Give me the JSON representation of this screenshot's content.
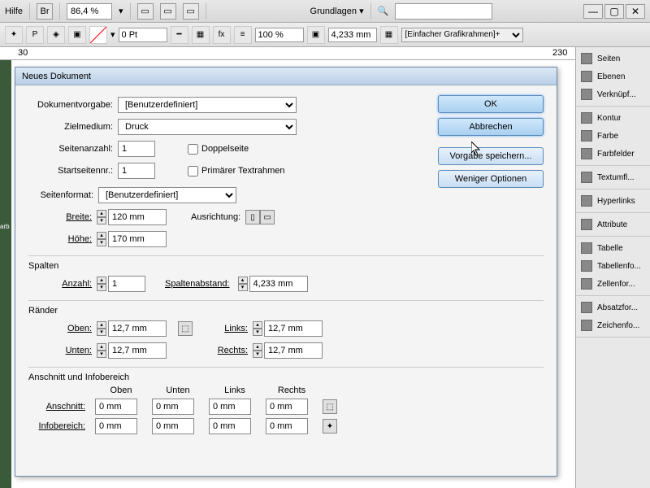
{
  "topbar": {
    "help": "Hilfe",
    "br": "Br",
    "zoom": "86,4 %",
    "workspace": "Grundlagen",
    "frame_preset": "[Einfacher Grafikrahmen]+"
  },
  "ctrl": {
    "weight": "0 Pt",
    "pct": "100 %",
    "measure": "4,233 mm"
  },
  "ruler": {
    "t1": "30",
    "t2": "230"
  },
  "dialog": {
    "title": "Neues Dokument",
    "preset_lbl": "Dokumentvorgabe:",
    "preset": "[Benutzerdefiniert]",
    "intent_lbl": "Zielmedium:",
    "intent": "Druck",
    "pages_lbl": "Seitenanzahl:",
    "pages": "1",
    "facing": "Doppelseite",
    "start_lbl": "Startseitennr.:",
    "start": "1",
    "primary": "Primärer Textrahmen",
    "size_lbl": "Seitenformat:",
    "size": "[Benutzerdefiniert]",
    "width_lbl": "Breite:",
    "width": "120 mm",
    "height_lbl": "Höhe:",
    "height": "170 mm",
    "orient_lbl": "Ausrichtung:",
    "cols_title": "Spalten",
    "cols_lbl": "Anzahl:",
    "cols": "1",
    "gutter_lbl": "Spaltenabstand:",
    "gutter": "4,233 mm",
    "marg_title": "Ränder",
    "top": "Oben:",
    "bottom": "Unten:",
    "left": "Links:",
    "right": "Rechts:",
    "marg": "12,7 mm",
    "bleed_title": "Anschnitt und Infobereich",
    "h_top": "Oben",
    "h_bottom": "Unten",
    "h_left": "Links",
    "h_right": "Rechts",
    "bleed_lbl": "Anschnitt:",
    "slug_lbl": "Infobereich:",
    "zero": "0 mm",
    "ok": "OK",
    "cancel": "Abbrechen",
    "save": "Vorgabe speichern...",
    "less": "Weniger Optionen"
  },
  "panels": [
    [
      {
        "ic": "seiten-icon",
        "l": "Seiten"
      },
      {
        "ic": "ebenen-icon",
        "l": "Ebenen"
      },
      {
        "ic": "links-icon",
        "l": "Verknüpf..."
      }
    ],
    [
      {
        "ic": "kontur-icon",
        "l": "Kontur"
      },
      {
        "ic": "farbe-icon",
        "l": "Farbe"
      },
      {
        "ic": "farbfelder-icon",
        "l": "Farbfelder"
      }
    ],
    [
      {
        "ic": "textumfl-icon",
        "l": "Textumfl..."
      }
    ],
    [
      {
        "ic": "hyperlinks-icon",
        "l": "Hyperlinks"
      }
    ],
    [
      {
        "ic": "attribute-icon",
        "l": "Attribute"
      }
    ],
    [
      {
        "ic": "tabelle-icon",
        "l": "Tabelle"
      },
      {
        "ic": "tabellenfo-icon",
        "l": "Tabellenfo..."
      },
      {
        "ic": "zellenfor-icon",
        "l": "Zellenfor..."
      }
    ],
    [
      {
        "ic": "absatzfor-icon",
        "l": "Absatzfor..."
      },
      {
        "ic": "zeichenfo-icon",
        "l": "Zeichenfo..."
      }
    ]
  ]
}
